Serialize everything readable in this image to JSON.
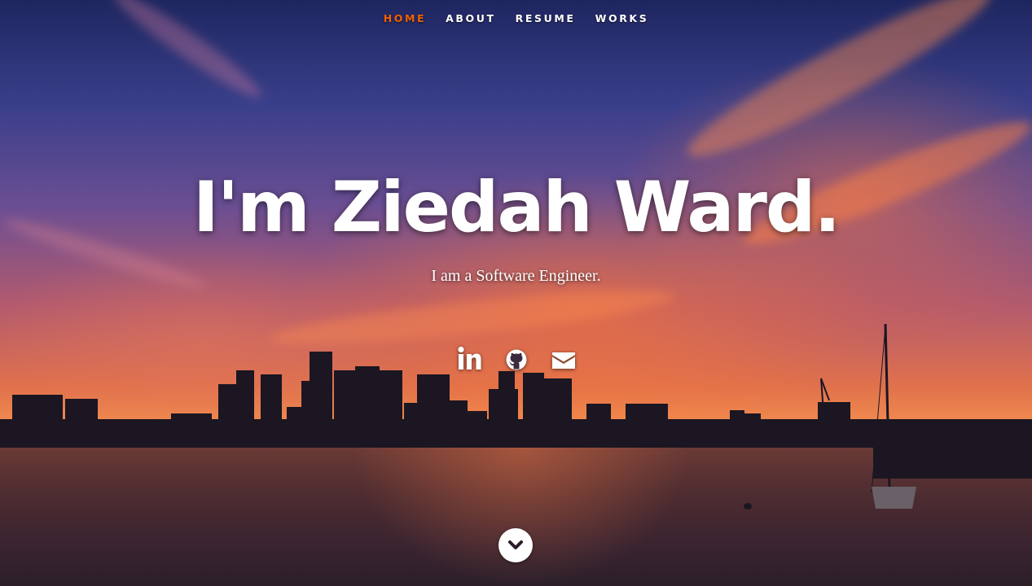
{
  "nav": {
    "items": [
      {
        "label": "HOME",
        "active": true
      },
      {
        "label": "ABOUT",
        "active": false
      },
      {
        "label": "RESUME",
        "active": false
      },
      {
        "label": "WORKS",
        "active": false
      }
    ],
    "active_color": "#f06000"
  },
  "banner": {
    "headline": "I'm Ziedah Ward.",
    "subtitle": "I am a Software Engineer."
  },
  "social": {
    "icons": [
      "linkedin-icon",
      "github-icon",
      "envelope-icon"
    ]
  },
  "scroll": {
    "icon": "chevron-down-icon"
  }
}
